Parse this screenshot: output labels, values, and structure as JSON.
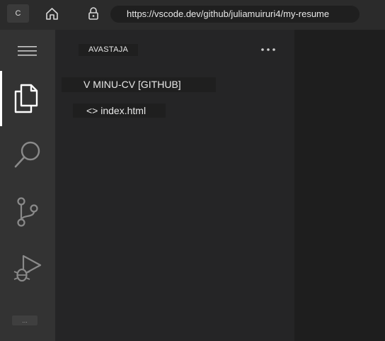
{
  "browser": {
    "tab_letter": "C",
    "url": "https://vscode.dev/github/juliamuiruri4/my-resume"
  },
  "activity_bar": {
    "items": [
      {
        "icon": "files-icon",
        "active": true
      },
      {
        "icon": "search-icon",
        "active": false
      },
      {
        "icon": "source-control-icon",
        "active": false
      },
      {
        "icon": "run-debug-icon",
        "active": false
      }
    ],
    "accounts_label": "..."
  },
  "explorer": {
    "title": "AVASTAJA",
    "more_label": "•••",
    "folder_label": "V MINU-CV [GITHUB]",
    "files": [
      {
        "label": "<> index.html"
      }
    ]
  },
  "colors": {
    "activity_bar": "#333333",
    "side_panel": "#252526",
    "editor": "#1e1e1e",
    "browser_bar": "#2b2b2b"
  }
}
